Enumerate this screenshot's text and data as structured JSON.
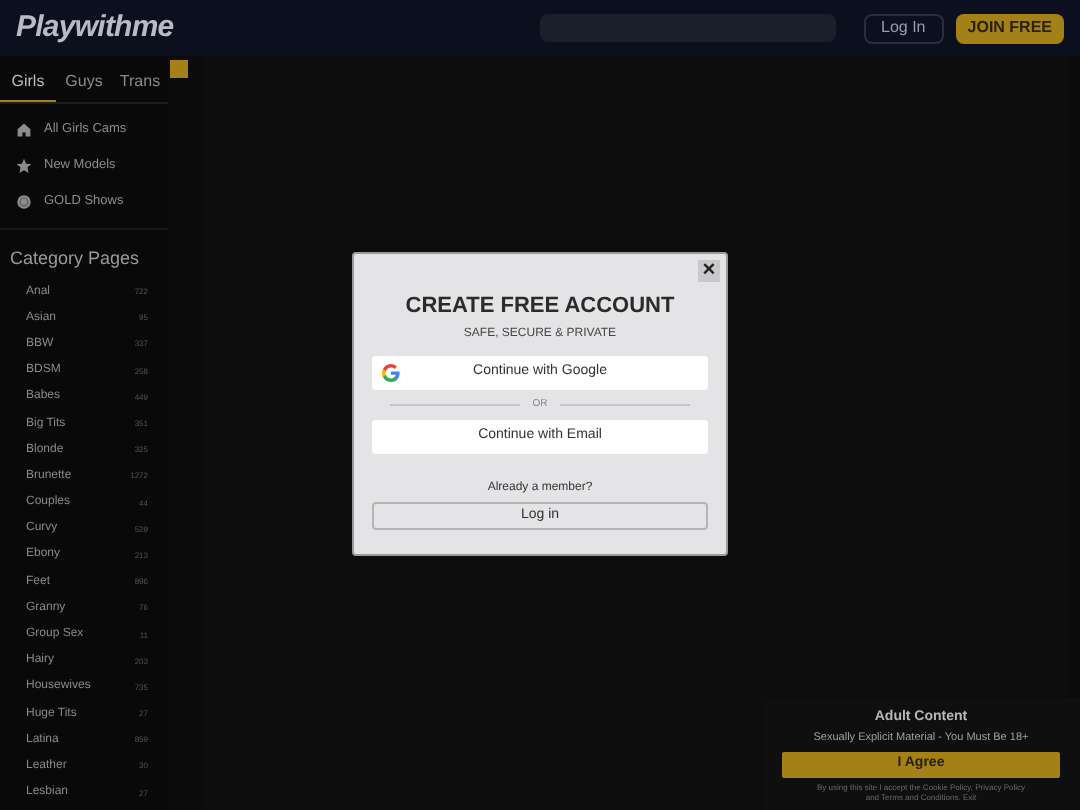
{
  "header": {
    "logo": "Playwithme",
    "login": "Log In",
    "join": "JOIN FREE"
  },
  "tabs": [
    {
      "label": "Girls",
      "selected": true
    },
    {
      "label": "Guys",
      "selected": false
    },
    {
      "label": "Trans",
      "selected": false
    }
  ],
  "nav": [
    {
      "label": "All Girls Cams"
    },
    {
      "label": "New Models"
    },
    {
      "label": "GOLD Shows"
    }
  ],
  "categories": {
    "title": "Category Pages",
    "items": [
      {
        "name": "Anal",
        "count": "722"
      },
      {
        "name": "Asian",
        "count": "95"
      },
      {
        "name": "BBW",
        "count": "337"
      },
      {
        "name": "BDSM",
        "count": "258"
      },
      {
        "name": "Babes",
        "count": "449"
      },
      {
        "name": "Big Tits",
        "count": "351"
      },
      {
        "name": "Blonde",
        "count": "325"
      },
      {
        "name": "Brunette",
        "count": "1272"
      },
      {
        "name": "Couples",
        "count": "44"
      },
      {
        "name": "Curvy",
        "count": "529"
      },
      {
        "name": "Ebony",
        "count": "213"
      },
      {
        "name": "Feet",
        "count": "896"
      },
      {
        "name": "Granny",
        "count": "76"
      },
      {
        "name": "Group Sex",
        "count": "11"
      },
      {
        "name": "Hairy",
        "count": "203"
      },
      {
        "name": "Housewives",
        "count": "735"
      },
      {
        "name": "Huge Tits",
        "count": "27"
      },
      {
        "name": "Latina",
        "count": "859"
      },
      {
        "name": "Leather",
        "count": "30"
      },
      {
        "name": "Lesbian",
        "count": "27"
      }
    ]
  },
  "modal": {
    "close": "×",
    "title": "CREATE FREE ACCOUNT",
    "subtitle": "SAFE, SECURE & PRIVATE",
    "google": "Continue with Google",
    "or": "OR",
    "email": "Continue with Email",
    "member": "Already a member?",
    "login": "Log in"
  },
  "consent": {
    "title": "Adult Content",
    "subtitle": "Sexually Explicit Material - You Must Be 18+",
    "agree": "I Agree",
    "note": "By using this site I accept the Cookie Policy, Privacy Policy and Terms and Conditions. Exit"
  }
}
